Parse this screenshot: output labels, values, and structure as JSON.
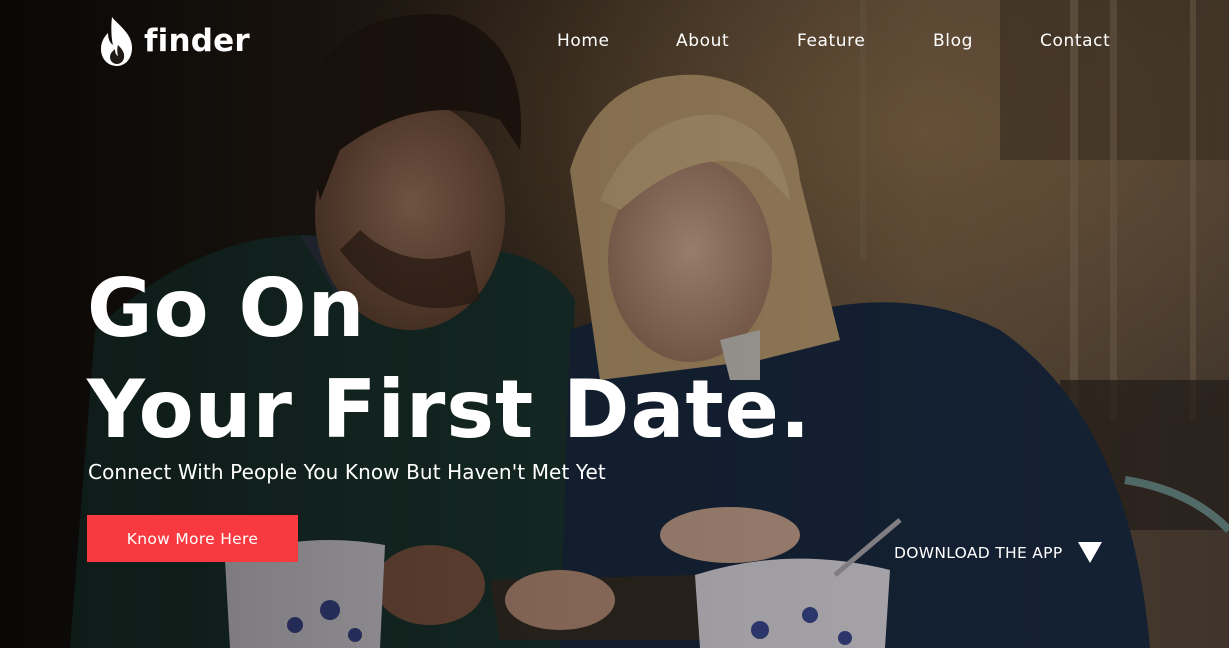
{
  "brand": {
    "name": "finder",
    "logo_icon": "flame-icon"
  },
  "nav": {
    "items": [
      "Home",
      "About",
      "Feature",
      "Blog",
      "Contact"
    ]
  },
  "hero": {
    "title_line1": "Go On",
    "title_line2": "Your First Date.",
    "subtitle": "Connect With People You Know But Haven't Met Yet",
    "cta_label": "Know More Here",
    "download_label": "DOWNLOAD THE APP",
    "download_icon": "triangle-down-icon"
  },
  "colors": {
    "accent": "#f8393f",
    "text": "#ffffff"
  }
}
